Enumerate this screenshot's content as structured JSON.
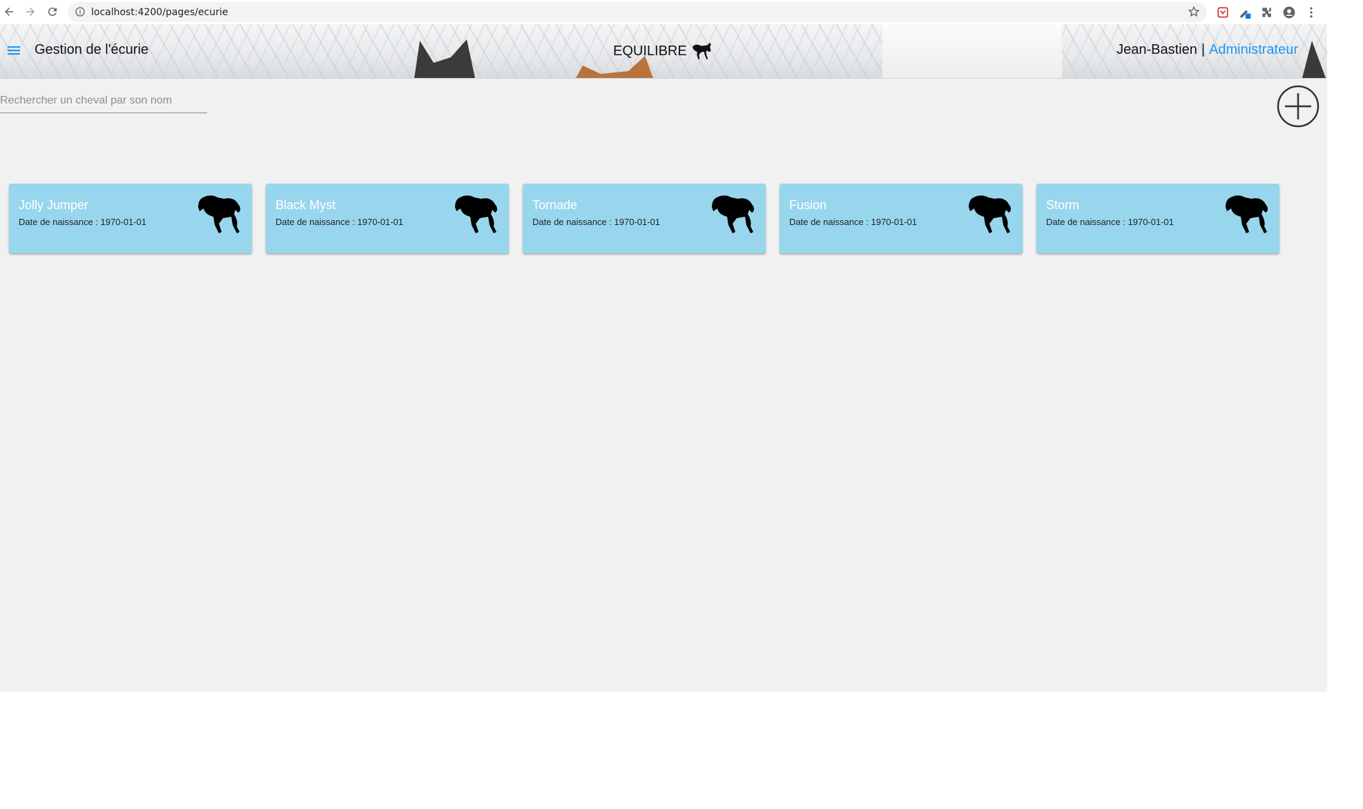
{
  "browser": {
    "url": "localhost:4200/pages/ecurie",
    "icons": [
      "back-arrow-icon",
      "forward-arrow-icon",
      "reload-icon",
      "info-icon",
      "star-icon",
      "shield-extension-icon",
      "pen-extension-icon",
      "puzzle-icon",
      "profile-icon",
      "kebab-menu-icon"
    ]
  },
  "header": {
    "title": "Gestion de l'écurie",
    "brand": "EQUILIBRE",
    "user_name": "Jean-Bastien",
    "separator": "|",
    "role": "Administrateur"
  },
  "search": {
    "placeholder": "Rechercher un cheval par son nom",
    "value": ""
  },
  "horses": [
    {
      "name": "Jolly Jumper",
      "dob_label": "Date de naissance : 1970-01-01"
    },
    {
      "name": "Black Myst",
      "dob_label": "Date de naissance : 1970-01-01"
    },
    {
      "name": "Tornade",
      "dob_label": "Date de naissance : 1970-01-01"
    },
    {
      "name": "Fusion",
      "dob_label": "Date de naissance : 1970-01-01"
    },
    {
      "name": "Storm",
      "dob_label": "Date de naissance : 1970-01-01"
    }
  ],
  "colors": {
    "app_background": "#f1f1f1",
    "card_background": "#98d6ed",
    "role_link": "#2196f3",
    "menu_icon": "#2196f3"
  }
}
